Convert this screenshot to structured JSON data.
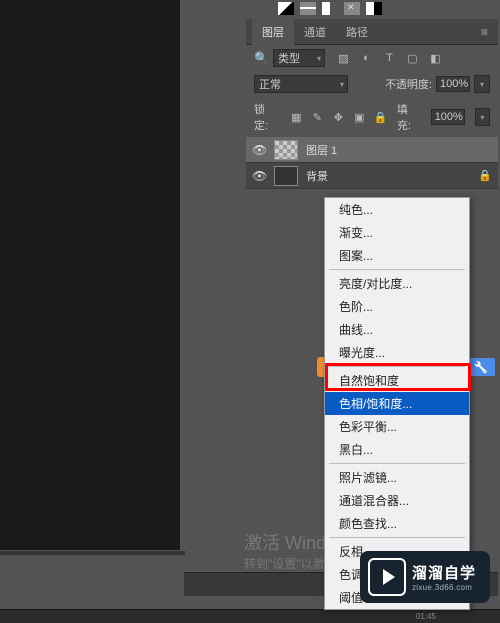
{
  "tabs": {
    "layers": "图层",
    "channels": "通道",
    "paths": "路径"
  },
  "filter": {
    "type_label": "类型"
  },
  "blend": {
    "mode": "正常",
    "opacity_label": "不透明度:",
    "opacity_value": "100%"
  },
  "lock": {
    "label": "锁定:",
    "fill_label": "填充:",
    "fill_value": "100%"
  },
  "layers": [
    {
      "name": "图层 1"
    },
    {
      "name": "背景"
    }
  ],
  "context_menu": {
    "group1": [
      "纯色...",
      "渐变...",
      "图案..."
    ],
    "group2": [
      "亮度/对比度...",
      "色阶...",
      "曲线...",
      "曝光度..."
    ],
    "group3": [
      "自然饱和度",
      "色相/饱和度...",
      "色彩平衡...",
      "黑白..."
    ],
    "group4": [
      "照片滤镜...",
      "通道混合器...",
      "颜色查找..."
    ],
    "group5": [
      "反相",
      "色调分离...",
      "阈值..."
    ]
  },
  "watermark": {
    "title": "激活 Window",
    "sub": "转到\"设置\"以激活"
  },
  "logo": {
    "cn": "溜溜自学",
    "url": "zixue.3d66.com"
  },
  "footer_time": "01:45"
}
